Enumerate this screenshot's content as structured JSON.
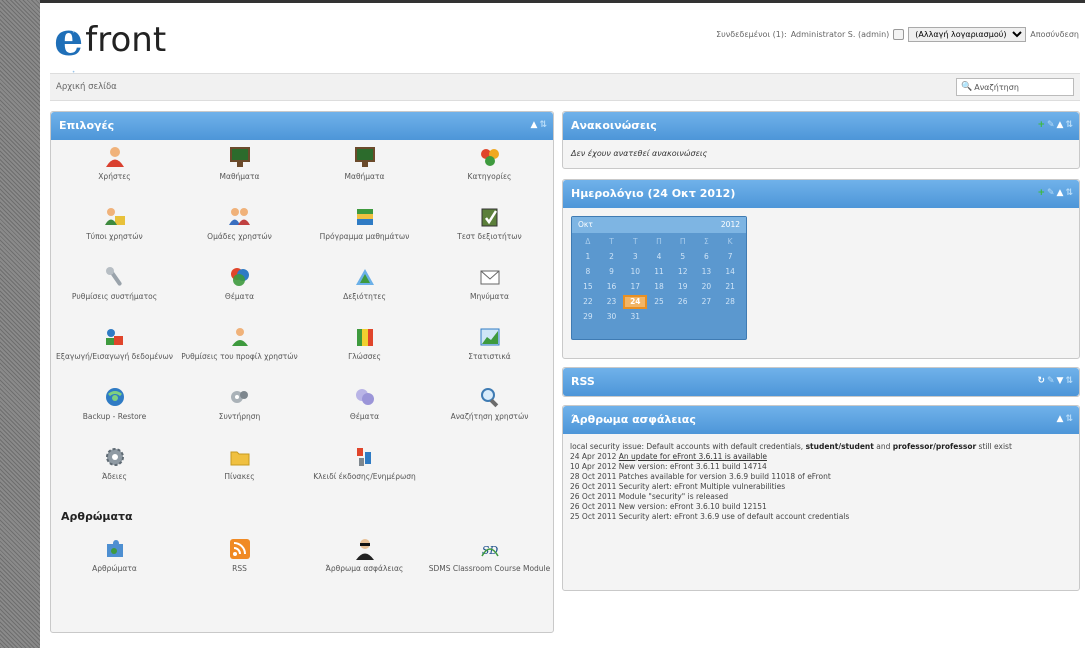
{
  "header": {
    "logo_e": "e",
    "logo_text": "front",
    "logged_in": "Συνδεδεμένοι (1):",
    "user": "Administrator S. (admin)",
    "account_select": "(Αλλαγή λογαριασμού)",
    "logout": "Αποσύνδεση"
  },
  "breadcrumb": "Αρχική σελίδα",
  "search": {
    "placeholder": "Αναζήτηση"
  },
  "options": {
    "title": "Επιλογές",
    "items": [
      {
        "label": "Χρήστες",
        "icon": "user-icon"
      },
      {
        "label": "Μαθήματα",
        "icon": "chalkboard-icon"
      },
      {
        "label": "Μαθήματα",
        "icon": "chalkboard-icon"
      },
      {
        "label": "Κατηγορίες",
        "icon": "categories-icon"
      },
      {
        "label": "Τύποι χρηστών",
        "icon": "user-types-icon"
      },
      {
        "label": "Ομάδες χρηστών",
        "icon": "user-groups-icon"
      },
      {
        "label": "Πρόγραμμα μαθημάτων",
        "icon": "curriculum-icon"
      },
      {
        "label": "Τεστ δεξιοτήτων",
        "icon": "skill-test-icon"
      },
      {
        "label": "Ρυθμίσεις συστήματος",
        "icon": "wrench-icon"
      },
      {
        "label": "Θέματα",
        "icon": "themes-icon"
      },
      {
        "label": "Δεξιότητες",
        "icon": "skills-icon"
      },
      {
        "label": "Μηνύματα",
        "icon": "envelope-icon"
      },
      {
        "label": "Εξαγωγή/Εισαγωγή δεδομένων",
        "icon": "import-export-icon"
      },
      {
        "label": "Ρυθμίσεις του προφίλ χρηστών",
        "icon": "profile-settings-icon"
      },
      {
        "label": "Γλώσσες",
        "icon": "languages-icon"
      },
      {
        "label": "Στατιστικά",
        "icon": "statistics-icon"
      },
      {
        "label": "Backup - Restore",
        "icon": "backup-icon"
      },
      {
        "label": "Συντήρηση",
        "icon": "maintenance-icon"
      },
      {
        "label": "Θέματα",
        "icon": "topics-icon"
      },
      {
        "label": "Αναζήτηση χρηστών",
        "icon": "search-users-icon"
      },
      {
        "label": "Άδειες",
        "icon": "gear-icon"
      },
      {
        "label": "Πίνακες",
        "icon": "folder-icon"
      },
      {
        "label": "Κλειδί έκδοσης/Ενημέρωση",
        "icon": "key-icon"
      }
    ],
    "modules_title": "Αρθρώματα",
    "modules": [
      {
        "label": "Αρθρώματα",
        "icon": "puzzle-icon"
      },
      {
        "label": "RSS",
        "icon": "rss-icon"
      },
      {
        "label": "Άρθρωμα ασφάλειας",
        "icon": "security-agent-icon"
      },
      {
        "label": "SDMS Classroom Course Module",
        "icon": "sdms-logo-icon"
      }
    ]
  },
  "announcements": {
    "title": "Ανακοινώσεις",
    "empty": "Δεν έχουν ανατεθεί ανακοινώσεις"
  },
  "calendar": {
    "title": "Ημερολόγιο (24 Οκτ 2012)",
    "month": "Οκτ",
    "year": "2012",
    "weekdays": [
      "Δ",
      "Τ",
      "Τ",
      "Π",
      "Π",
      "Σ",
      "Κ"
    ],
    "days": [
      "1",
      "2",
      "3",
      "4",
      "5",
      "6",
      "7",
      "8",
      "9",
      "10",
      "11",
      "12",
      "13",
      "14",
      "15",
      "16",
      "17",
      "18",
      "19",
      "20",
      "21",
      "22",
      "23",
      "24",
      "25",
      "26",
      "27",
      "28",
      "29",
      "30",
      "31"
    ],
    "today": "24"
  },
  "rss": {
    "title": "RSS"
  },
  "security": {
    "title": "Άρθρωμα ασφάλειας",
    "line1_pre": "local security issue: Default accounts with default credentials, ",
    "line1_bold1": "student/student",
    "line1_mid": " and ",
    "line1_bold2": "professor/professor",
    "line1_post": " still exist",
    "news": [
      {
        "date": "24 Apr 2012",
        "text": "An update for eFront 3.6.11 is available",
        "link": true
      },
      {
        "date": "10 Apr 2012",
        "text": "New version: eFront 3.6.11 build 14714",
        "link": false
      },
      {
        "date": "28 Oct 2011",
        "text": "Patches available for version 3.6.9 build 11018 of eFront",
        "link": false
      },
      {
        "date": "26 Oct 2011",
        "text": "Security alert: eFront Multiple vulnerabilities",
        "link": false
      },
      {
        "date": "26 Oct 2011",
        "text": "Module \"security\" is released",
        "link": false
      },
      {
        "date": "26 Oct 2011",
        "text": "New version: eFront 3.6.10 build 12151",
        "link": false
      },
      {
        "date": "25 Oct 2011",
        "text": "Security alert: eFront 3.6.9 use of default account credentials",
        "link": false
      }
    ]
  }
}
